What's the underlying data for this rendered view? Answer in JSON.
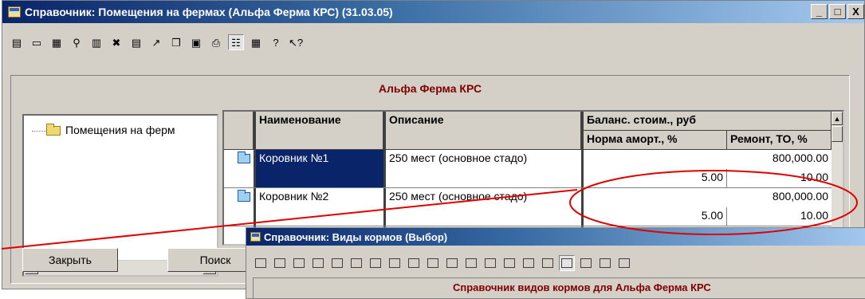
{
  "main_window": {
    "title": "Справочник: Помещения на фермах (Альфа Ферма КРС) (31.03.05)",
    "controls": {
      "minimize": "_",
      "maximize": "□",
      "close": "X"
    },
    "toolbar_icons": [
      "new-record-icon",
      "new-folder-icon",
      "edit-icon",
      "find-icon",
      "add-row-icon",
      "delete-mark-icon",
      "copy-row-icon",
      "move-icon",
      "copy-icon",
      "paste-icon",
      "print-icon",
      "tree-view-icon",
      "export-icon",
      "help-icon",
      "context-help-icon"
    ],
    "toolbar_glyphs": [
      "▤",
      "▭",
      "▦",
      "⚲",
      "▥",
      "✖",
      "▤",
      "↗",
      "❐",
      "▣",
      "⎙",
      "☷",
      "▦",
      "?",
      "↖?"
    ]
  },
  "header": {
    "title": "Альфа Ферма КРС"
  },
  "tree": {
    "root_label": "Помещения на ферм"
  },
  "grid": {
    "columns": {
      "name": "Наименование",
      "description": "Описание",
      "balance": "Баланс. стоим., руб",
      "depreciation": "Норма аморт., %",
      "repair": "Ремонт, ТО, %"
    },
    "rows": [
      {
        "name": "Коровник №1",
        "description": "250 мест (основное стадо)",
        "balance": "800,000.00",
        "depreciation": "5.00",
        "repair": "10.00"
      },
      {
        "name": "Коровник №2",
        "description": "250 мест (основное стадо)",
        "balance": "800,000.00",
        "depreciation": "5.00",
        "repair": "10.00"
      }
    ]
  },
  "buttons": {
    "close": "Закрыть",
    "search": "Поиск"
  },
  "second_window": {
    "title": "Справочник: Виды кормов (Выбор)",
    "header": "Справочник видов кормов для Альфа Ферма КРС",
    "toolbar_icons": [
      "new-record-icon",
      "new-folder-icon",
      "edit-icon",
      "find-icon",
      "add-row-icon",
      "delete-mark-icon",
      "copy-row-icon",
      "move-in-icon",
      "move-out-icon",
      "filter-icon",
      "group-icon",
      "import-icon",
      "move-icon",
      "copy-icon",
      "paste-icon",
      "print-icon",
      "tree-view-icon",
      "export-icon",
      "help-icon",
      "context-help-icon"
    ]
  },
  "colors": {
    "title_bar": "#0a246a",
    "header_text": "#800000",
    "selection": "#0a246a",
    "annotation": "#e00000"
  }
}
